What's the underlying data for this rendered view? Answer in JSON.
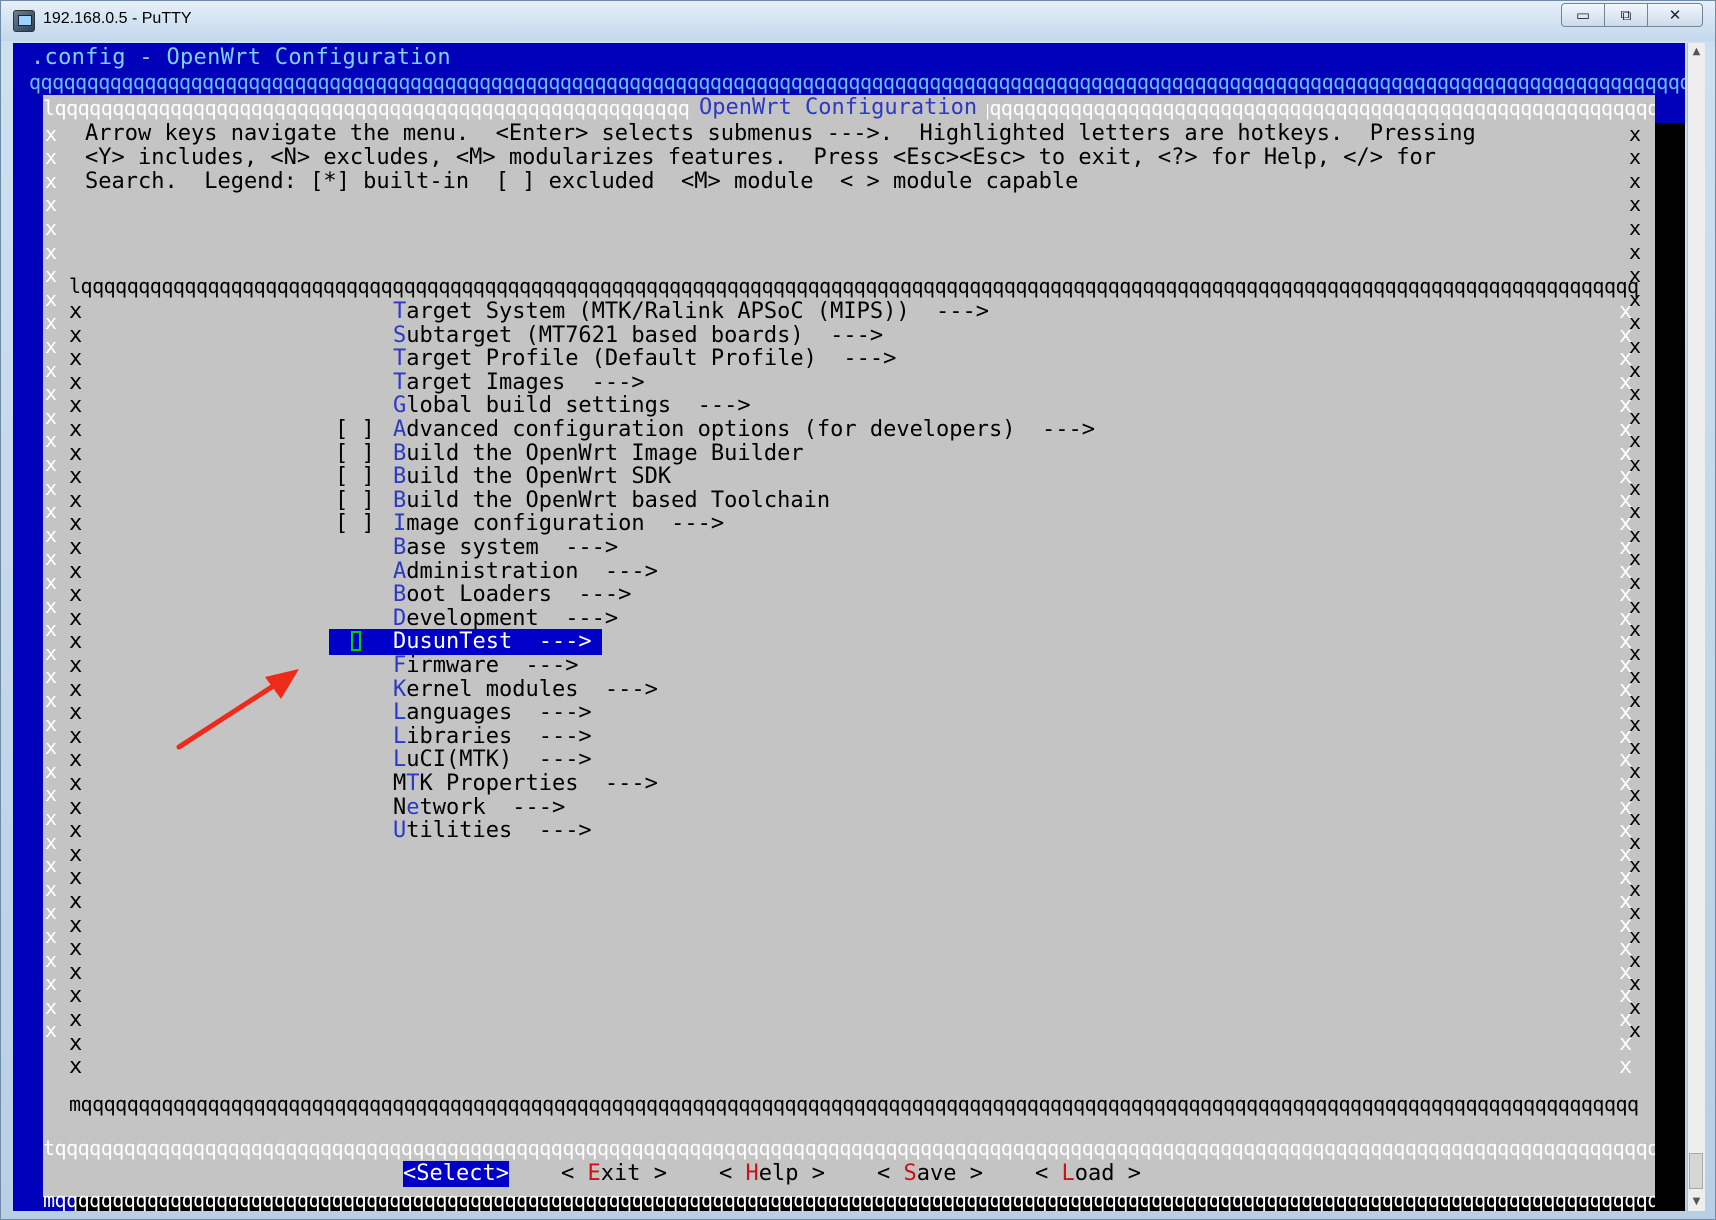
{
  "window": {
    "title": "192.168.0.5 - PuTTY",
    "min_glyph": "▭",
    "max_glyph": "⧉",
    "close_glyph": "✕"
  },
  "terminal": {
    "config_title": ".config - OpenWrt Configuration",
    "dialog_title": "OpenWrt Configuration",
    "help_lines": [
      "Arrow keys navigate the menu.  <Enter> selects submenus --->.  Highlighted letters are hotkeys.  Pressing",
      "<Y> includes, <N> excludes, <M> modularizes features.  Press <Esc><Esc> to exit, <?> for Help, </> for",
      "Search.  Legend: [*] built-in  [ ] excluded  <M> module  < > module capable"
    ],
    "menu_items": [
      {
        "prefix": "",
        "hot": "T",
        "rest": "arget System (MTK/Ralink APSoC (MIPS))  --->"
      },
      {
        "prefix": "",
        "hot": "S",
        "rest": "ubtarget (MT7621 based boards)  --->"
      },
      {
        "prefix": "",
        "hot": "T",
        "rest": "arget Profile (Default Profile)  --->"
      },
      {
        "prefix": "",
        "hot": "T",
        "rest": "arget Images  --->"
      },
      {
        "prefix": "",
        "hot": "G",
        "rest": "lobal build settings  --->"
      },
      {
        "prefix": "[ ]",
        "hot": "A",
        "rest": "dvanced configuration options (for developers)  --->"
      },
      {
        "prefix": "[ ]",
        "hot": "B",
        "rest": "uild the OpenWrt Image Builder"
      },
      {
        "prefix": "[ ]",
        "hot": "B",
        "rest": "uild the OpenWrt SDK"
      },
      {
        "prefix": "[ ]",
        "hot": "B",
        "rest": "uild the OpenWrt based Toolchain"
      },
      {
        "prefix": "[ ]",
        "hot": "I",
        "rest": "mage configuration  --->"
      },
      {
        "prefix": "",
        "hot": "B",
        "rest": "ase system  --->"
      },
      {
        "prefix": "",
        "hot": "A",
        "rest": "dministration  --->"
      },
      {
        "prefix": "",
        "hot": "B",
        "rest": "oot Loaders  --->"
      },
      {
        "prefix": "",
        "hot": "D",
        "rest": "evelopment  --->"
      },
      {
        "prefix": "",
        "hot": "",
        "rest": "DusunTest  --->",
        "selected": true
      },
      {
        "prefix": "",
        "hot": "F",
        "rest": "irmware  --->"
      },
      {
        "prefix": "",
        "hot": "K",
        "rest": "ernel modules  --->"
      },
      {
        "prefix": "",
        "hot": "L",
        "rest": "anguages  --->"
      },
      {
        "prefix": "",
        "hot": "L",
        "rest": "ibraries  --->"
      },
      {
        "prefix": "",
        "hot": "L",
        "rest": "uCI(MTK)  --->"
      },
      {
        "prefix": "M",
        "hot": "T",
        "rest": "K Properties  --->",
        "split": true
      },
      {
        "prefix": "N",
        "hot": "e",
        "rest": "twork  --->",
        "split": true
      },
      {
        "prefix": "",
        "hot": "U",
        "rest": "tilities  --->"
      }
    ],
    "buttons": [
      {
        "open": "<",
        "hk": "Select",
        "close": ">",
        "active": true
      },
      {
        "open": "< ",
        "hk": "E",
        "rest": "xit",
        "close": " >"
      },
      {
        "open": "< ",
        "hk": "H",
        "rest": "elp",
        "close": " >"
      },
      {
        "open": "< ",
        "hk": "S",
        "rest": "ave",
        "close": " >"
      },
      {
        "open": "< ",
        "hk": "L",
        "rest": "oad",
        "close": " >"
      }
    ]
  },
  "colors": {
    "terminal_bg": "#0000bb",
    "dialog_bg": "#c4c4c4",
    "highlight": "#0000c8",
    "hotkey": "#2c38c8",
    "button_hotkey": "#d01010",
    "annotation_arrow": "#ee2a1a"
  }
}
